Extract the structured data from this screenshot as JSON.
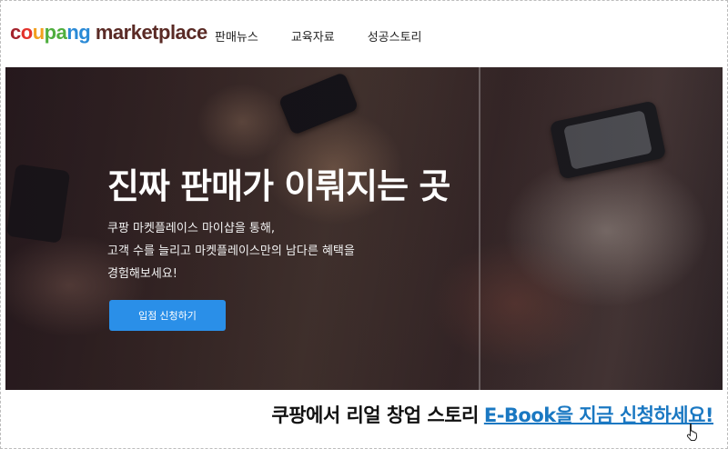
{
  "header": {
    "logo": {
      "c1": "c",
      "c2": "o",
      "c3": "u",
      "c4": "pa",
      "c5": "ng",
      "rest": " marketplace"
    },
    "nav": [
      {
        "label": "판매뉴스"
      },
      {
        "label": "교육자료"
      },
      {
        "label": "성공스토리"
      }
    ]
  },
  "hero": {
    "title": "진짜 판매가 이뤄지는 곳",
    "description": [
      "쿠팡 마켓플레이스 마이샵을 통해,",
      "고객 수를 늘리고 마켓플레이스만의 남다른 혜택을",
      "경험해보세요!"
    ],
    "cta_label": "입점 신청하기"
  },
  "banner": {
    "text": "쿠팡에서 리얼 창업 스토리",
    "link_text": "E-Book을 지금 신청하세요!"
  },
  "colors": {
    "accent": "#2a8fe8",
    "link": "#1a78c2"
  }
}
